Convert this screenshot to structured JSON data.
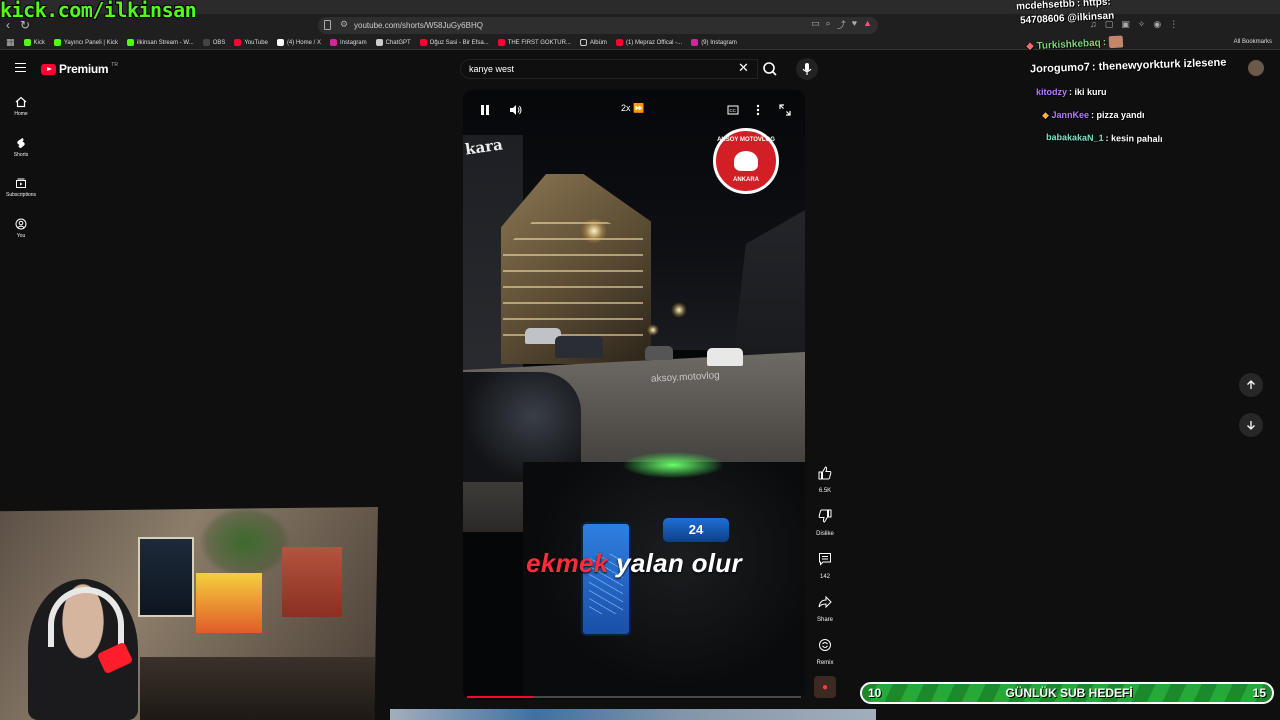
{
  "browser": {
    "url": "youtube.com/shorts/W58JuGy6BHQ",
    "bookmarks": [
      "Kick",
      "Yayıncı Paneli | Kick",
      "ilkinsan Stream - W...",
      "OBS",
      "YouTube",
      "(4) Home / X",
      "Instagram",
      "ChatGPT",
      "Oğuz Sasi - Bir Efsa...",
      "THE FIRST GOKTUR...",
      "Albüm",
      "(1) Mepraz Offical -...",
      "(9) Instagram"
    ],
    "all_bookmarks": "All Bookmarks"
  },
  "kick_overlay": "kick.com/ilkinsan",
  "youtube": {
    "brand": "Premium",
    "brand_sup": "TR",
    "search_query": "kanye west",
    "guide": [
      {
        "label": "Home",
        "icon": "home-icon"
      },
      {
        "label": "Shorts",
        "icon": "shorts-icon"
      },
      {
        "label": "Subscriptions",
        "icon": "subscriptions-icon"
      },
      {
        "label": "You",
        "icon": "you-icon"
      }
    ]
  },
  "short": {
    "speed": "2x",
    "caption_red": "ekmek",
    "caption_white": "yalan olur",
    "watermark": "aksoy.motovlog",
    "channel_logo_top": "AKSOY MOTOVLOG",
    "channel_logo_bottom": "ANKARA",
    "sign_text": "kara",
    "dash_speed": "24",
    "progress": 0.2
  },
  "actions": {
    "like_count": "6.5K",
    "dislike_label": "Dislike",
    "comment_count": "142",
    "share_label": "Share",
    "remix_label": "Remix"
  },
  "chat": [
    {
      "user": "mcdehsetbb",
      "msg": "https:",
      "color": "#ffffff"
    },
    {
      "user": "",
      "msg": "54708606 @ilkinsan",
      "color": "#ffffff"
    },
    {
      "user": "Turkishkebaq",
      "msg": "",
      "color": "#7cd87c"
    },
    {
      "user": "Jorogumo7",
      "msg": "thenewyorkturk izlesene",
      "color": "#ffffff"
    },
    {
      "user": "kitodzy",
      "msg": "iki kuru",
      "color": "#b77cff"
    },
    {
      "user": "JannKee",
      "msg": "pizza yandı",
      "color": "#b77cff"
    },
    {
      "user": "babakakaN_1",
      "msg": "kesin pahalı",
      "color": "#7fe0c8"
    }
  ],
  "sub_goal": {
    "current": "10",
    "label": "GÜNLÜK SUB HEDEFİ",
    "target": "15"
  },
  "colors": {
    "kick_green": "#53fc18",
    "yt_red": "#ff0033",
    "goal_green": "#27a83a"
  }
}
